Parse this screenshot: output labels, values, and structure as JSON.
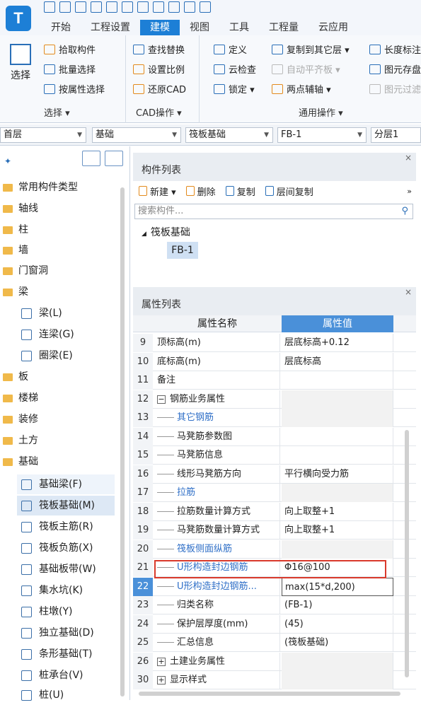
{
  "ribbon_tabs": [
    "开始",
    "工程设置",
    "建模",
    "视图",
    "工具",
    "工程量",
    "云应用"
  ],
  "active_tab": "建模",
  "select_group": {
    "big_button": "选择",
    "buttons": [
      "拾取构件",
      "批量选择",
      "按属性选择"
    ],
    "label": "选择 ▾"
  },
  "cad_group": {
    "buttons": [
      "查找替换",
      "设置比例",
      "还原CAD"
    ],
    "label": "CAD操作 ▾"
  },
  "common_group": {
    "col1": [
      "定义",
      "云检查",
      "锁定 ▾"
    ],
    "col2": [
      "复制到其它层 ▾",
      "自动平齐板 ▾",
      "两点辅轴 ▾"
    ],
    "col3": [
      "长度标注",
      "图元存盘",
      "图元过滤"
    ],
    "label": "通用操作 ▾"
  },
  "combos": [
    "首层",
    "基础",
    "筏板基础",
    "FB-1",
    "分层1"
  ],
  "tree": {
    "top": [
      "常用构件类型",
      "轴线",
      "柱",
      "墙",
      "门窗洞",
      "梁"
    ],
    "beam_children": [
      "梁(L)",
      "连梁(G)",
      "圈梁(E)"
    ],
    "mid": [
      "板",
      "楼梯",
      "装修",
      "土方",
      "基础"
    ],
    "found_children": [
      "基础梁(F)",
      "筏板基础(M)",
      "筏板主筋(R)",
      "筏板负筋(X)",
      "基础板带(W)",
      "集水坑(K)",
      "柱墩(Y)",
      "独立基础(D)",
      "条形基础(T)",
      "桩承台(V)",
      "桩(U)"
    ]
  },
  "component_list": {
    "title": "构件列表",
    "new": "新建 ▾",
    "delete": "删除",
    "copy": "复制",
    "layer_copy": "层间复制",
    "search_placeholder": "搜索构件...",
    "group": "筏板基础",
    "item": "FB-1"
  },
  "property_list": {
    "title": "属性列表",
    "col_name": "属性名称",
    "col_value": "属性值",
    "rows": [
      {
        "num": "9",
        "name": "顶标高(m)",
        "value": "层底标高+0.12"
      },
      {
        "num": "10",
        "name": "底标高(m)",
        "value": "层底标高"
      },
      {
        "num": "11",
        "name": "备注",
        "value": ""
      },
      {
        "num": "12",
        "name": "钢筋业务属性",
        "value": "",
        "expander": "−"
      },
      {
        "num": "13",
        "name": "其它钢筋",
        "value": "",
        "child": true,
        "blue": true
      },
      {
        "num": "14",
        "name": "马凳筋参数图",
        "value": "",
        "child": true
      },
      {
        "num": "15",
        "name": "马凳筋信息",
        "value": "",
        "child": true
      },
      {
        "num": "16",
        "name": "线形马凳筋方向",
        "value": "平行横向受力筋",
        "child": true
      },
      {
        "num": "17",
        "name": "拉筋",
        "value": "",
        "child": true,
        "blue": true
      },
      {
        "num": "18",
        "name": "拉筋数量计算方式",
        "value": "向上取整+1",
        "child": true
      },
      {
        "num": "19",
        "name": "马凳筋数量计算方式",
        "value": "向上取整+1",
        "child": true
      },
      {
        "num": "20",
        "name": "筏板侧面纵筋",
        "value": "",
        "child": true,
        "blue": true
      },
      {
        "num": "21",
        "name": "U形构造封边钢筋",
        "value": "Φ16@100",
        "child": true,
        "blue": true
      },
      {
        "num": "22",
        "name": "U形构造封边钢筋...",
        "value": "max(15*d,200)",
        "child": true,
        "blue": true,
        "selected": true
      },
      {
        "num": "23",
        "name": "归类名称",
        "value": "(FB-1)",
        "child": true
      },
      {
        "num": "24",
        "name": "保护层厚度(mm)",
        "value": "(45)",
        "child": true
      },
      {
        "num": "25",
        "name": "汇总信息",
        "value": "(筏板基础)",
        "child": true
      },
      {
        "num": "26",
        "name": "土建业务属性",
        "value": "",
        "expander": "+"
      },
      {
        "num": "30",
        "name": "显示样式",
        "value": "",
        "expander": "+"
      }
    ]
  }
}
